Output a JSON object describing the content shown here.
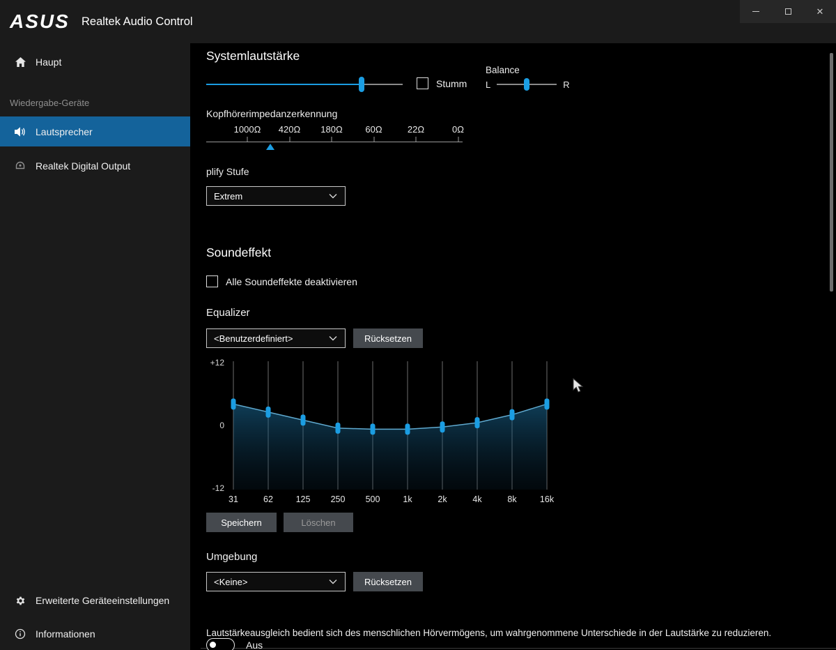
{
  "window": {
    "brand": "ASUS",
    "title": "Realtek Audio Control"
  },
  "sidebar": {
    "section_label": "Wiedergabe-Geräte",
    "items": [
      {
        "label": "Haupt"
      },
      {
        "label": "Lautsprecher"
      },
      {
        "label": "Realtek Digital Output"
      }
    ],
    "bottom_items": [
      {
        "label": "Erweiterte Geräteeinstellungen"
      },
      {
        "label": "Informationen"
      }
    ]
  },
  "main": {
    "system_volume": {
      "heading": "Systemlautstärke",
      "volume_percent": 79,
      "mute_label": "Stumm",
      "mute_checked": false,
      "balance": {
        "label": "Balance",
        "left": "L",
        "right": "R",
        "value_percent": 50
      }
    },
    "impedance": {
      "label": "Kopfhörerimpedanzerkennung",
      "ticks": [
        "1000Ω",
        "420Ω",
        "180Ω",
        "60Ω",
        "22Ω",
        "0Ω"
      ],
      "marker_offset_percent": 25
    },
    "amplify": {
      "label": "plify Stufe",
      "selected": "Extrem"
    },
    "soundeffekt": {
      "heading": "Soundeffekt",
      "disable_all_label": "Alle Soundeffekte deaktivieren",
      "disable_all_checked": false
    },
    "equalizer": {
      "label": "Equalizer",
      "preset_selected": "<Benutzerdefiniert>",
      "reset_button": "Rücksetzen",
      "save_button": "Speichern",
      "delete_button": "Löschen"
    },
    "environment": {
      "label": "Umgebung",
      "selected": "<Keine>",
      "reset_button": "Rücksetzen"
    },
    "loudness": {
      "description": "Lautstärkeausgleich bedient sich des menschlichen Hörvermögens, um wahrgenommene Unterschiede in der Lautstärke zu reduzieren.",
      "toggle_label": "Aus",
      "toggle_on": false
    }
  },
  "chart_data": {
    "type": "line",
    "title": "Equalizer",
    "categories": [
      "31",
      "62",
      "125",
      "250",
      "500",
      "1k",
      "2k",
      "4k",
      "8k",
      "16k"
    ],
    "values": [
      4,
      2.5,
      1,
      -0.5,
      -0.7,
      -0.7,
      -0.3,
      0.5,
      2,
      4
    ],
    "y_tick_labels": [
      "+12",
      "0",
      "-12"
    ],
    "ylim": [
      -12,
      12
    ],
    "xlabel": "",
    "ylabel": "",
    "grid": "vertical-band-lines",
    "legend": "none"
  },
  "colors": {
    "accent": "#1b9de2",
    "selected_nav_bg": "#14639b",
    "titlebar_bg": "#1b1b1b",
    "main_bg": "#000000",
    "button_bg": "#45494e"
  }
}
